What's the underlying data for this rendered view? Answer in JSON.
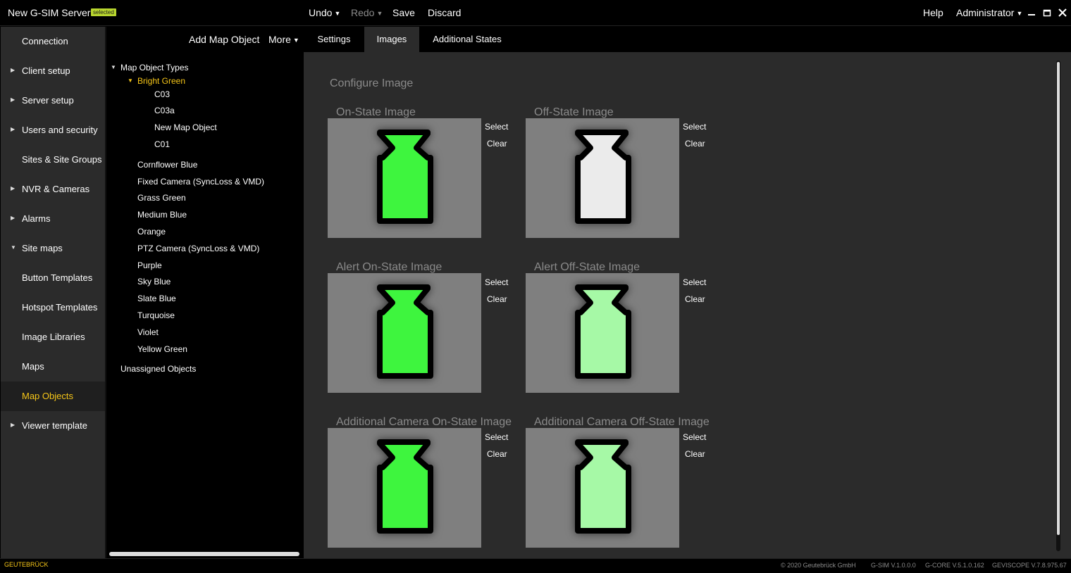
{
  "window": {
    "title": "New G-SIM Server",
    "badge": "selected",
    "undo": "Undo",
    "redo": "Redo",
    "save": "Save",
    "discard": "Discard",
    "help": "Help",
    "user": "Administrator"
  },
  "sidebar": {
    "items": [
      {
        "label": "Connection"
      },
      {
        "label": "Client setup"
      },
      {
        "label": "Server setup"
      },
      {
        "label": "Users and security"
      },
      {
        "label": "Sites & Site Groups"
      },
      {
        "label": "NVR & Cameras"
      },
      {
        "label": "Alarms"
      },
      {
        "label": "Site maps"
      },
      {
        "label": "Button Templates"
      },
      {
        "label": "Hotspot Templates"
      },
      {
        "label": "Image Libraries"
      },
      {
        "label": "Maps"
      },
      {
        "label": "Map Objects"
      },
      {
        "label": "Viewer template"
      }
    ]
  },
  "tree": {
    "add_button": "Add Map Object",
    "more_button": "More",
    "root": "Map Object Types",
    "expanded_type": "Bright Green",
    "children": [
      "C03",
      "C03a",
      "New Map Object",
      "C01"
    ],
    "types": [
      "Cornflower Blue",
      "Fixed Camera (SyncLoss & VMD)",
      "Grass Green",
      "Medium Blue",
      "Orange",
      "PTZ Camera (SyncLoss & VMD)",
      "Purple",
      "Sky Blue",
      "Slate Blue",
      "Turquoise",
      "Violet",
      "Yellow Green"
    ],
    "unassigned": "Unassigned Objects"
  },
  "tabs": [
    "Settings",
    "Images",
    "Additional States"
  ],
  "content": {
    "section_title": "Configure Image",
    "select_label": "Select",
    "clear_label": "Clear",
    "images": [
      {
        "label": "On-State Image",
        "fill": "#3ef53e"
      },
      {
        "label": "Off-State Image",
        "fill": "#ebebeb"
      },
      {
        "label": "Alert On-State Image",
        "fill": "#3ef53e"
      },
      {
        "label": "Alert Off-State Image",
        "fill": "#a6f9a6"
      },
      {
        "label": "Additional Camera On-State Image",
        "fill": "#3ef53e"
      },
      {
        "label": "Additional Camera Off-State Image",
        "fill": "#a6f9a6"
      }
    ]
  },
  "footer": {
    "brand": "GEUTEBRÜCK",
    "copyright": "© 2020 Geutebrück GmbH",
    "gsim_version": "G-SIM V.1.0.0.0",
    "gcore_version": "G-CORE V.5.1.0.162",
    "geviscope_version": "GEVISCOPE V.7.8.975.67"
  },
  "colors": {
    "accent": "#f5c518",
    "badge": "#b8d62e",
    "bright_green": "#3ef53e",
    "light_green": "#a6f9a6",
    "off_white": "#ebebeb"
  }
}
